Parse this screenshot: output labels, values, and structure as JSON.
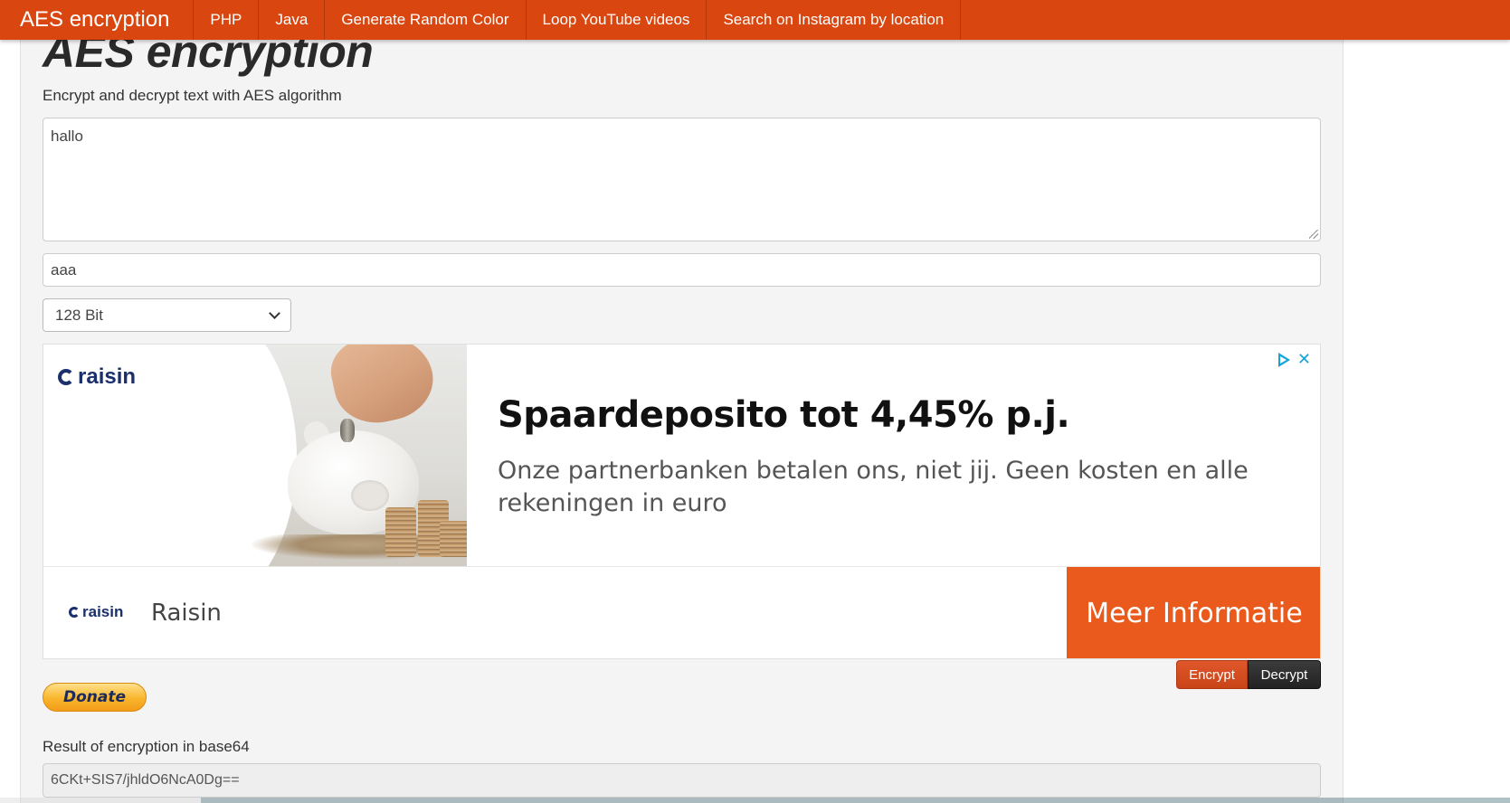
{
  "navbar": {
    "brand": "AES encryption",
    "items": [
      "PHP",
      "Java",
      "Generate Random Color",
      "Loop YouTube videos",
      "Search on Instagram by location"
    ]
  },
  "main": {
    "title": "AES encryption",
    "subtitle": "Encrypt and decrypt text with AES algorithm",
    "text_value": "hallo",
    "key_value": "aaa",
    "key_size_selected": "128 Bit"
  },
  "ad": {
    "logo_text": "raisin",
    "headline": "Spaardeposito tot 4,45% p.j.",
    "body": "Onze partnerbanken betalen ons, niet jij. Geen kosten en alle rekeningen in euro",
    "advertiser": "Raisin",
    "cta": "Meer Informatie",
    "close_symbol": "✕"
  },
  "actions": {
    "encrypt_label": "Encrypt",
    "decrypt_label": "Decrypt",
    "donate_label": "Donate"
  },
  "result": {
    "label": "Result of encryption in base64",
    "value": "6CKt+SIS7/jhldO6NcA0Dg=="
  },
  "colors": {
    "navbar": "#d9460f",
    "cta": "#ea5a1c",
    "encrypt": "#d24d20",
    "decrypt": "#2a2a2a"
  }
}
